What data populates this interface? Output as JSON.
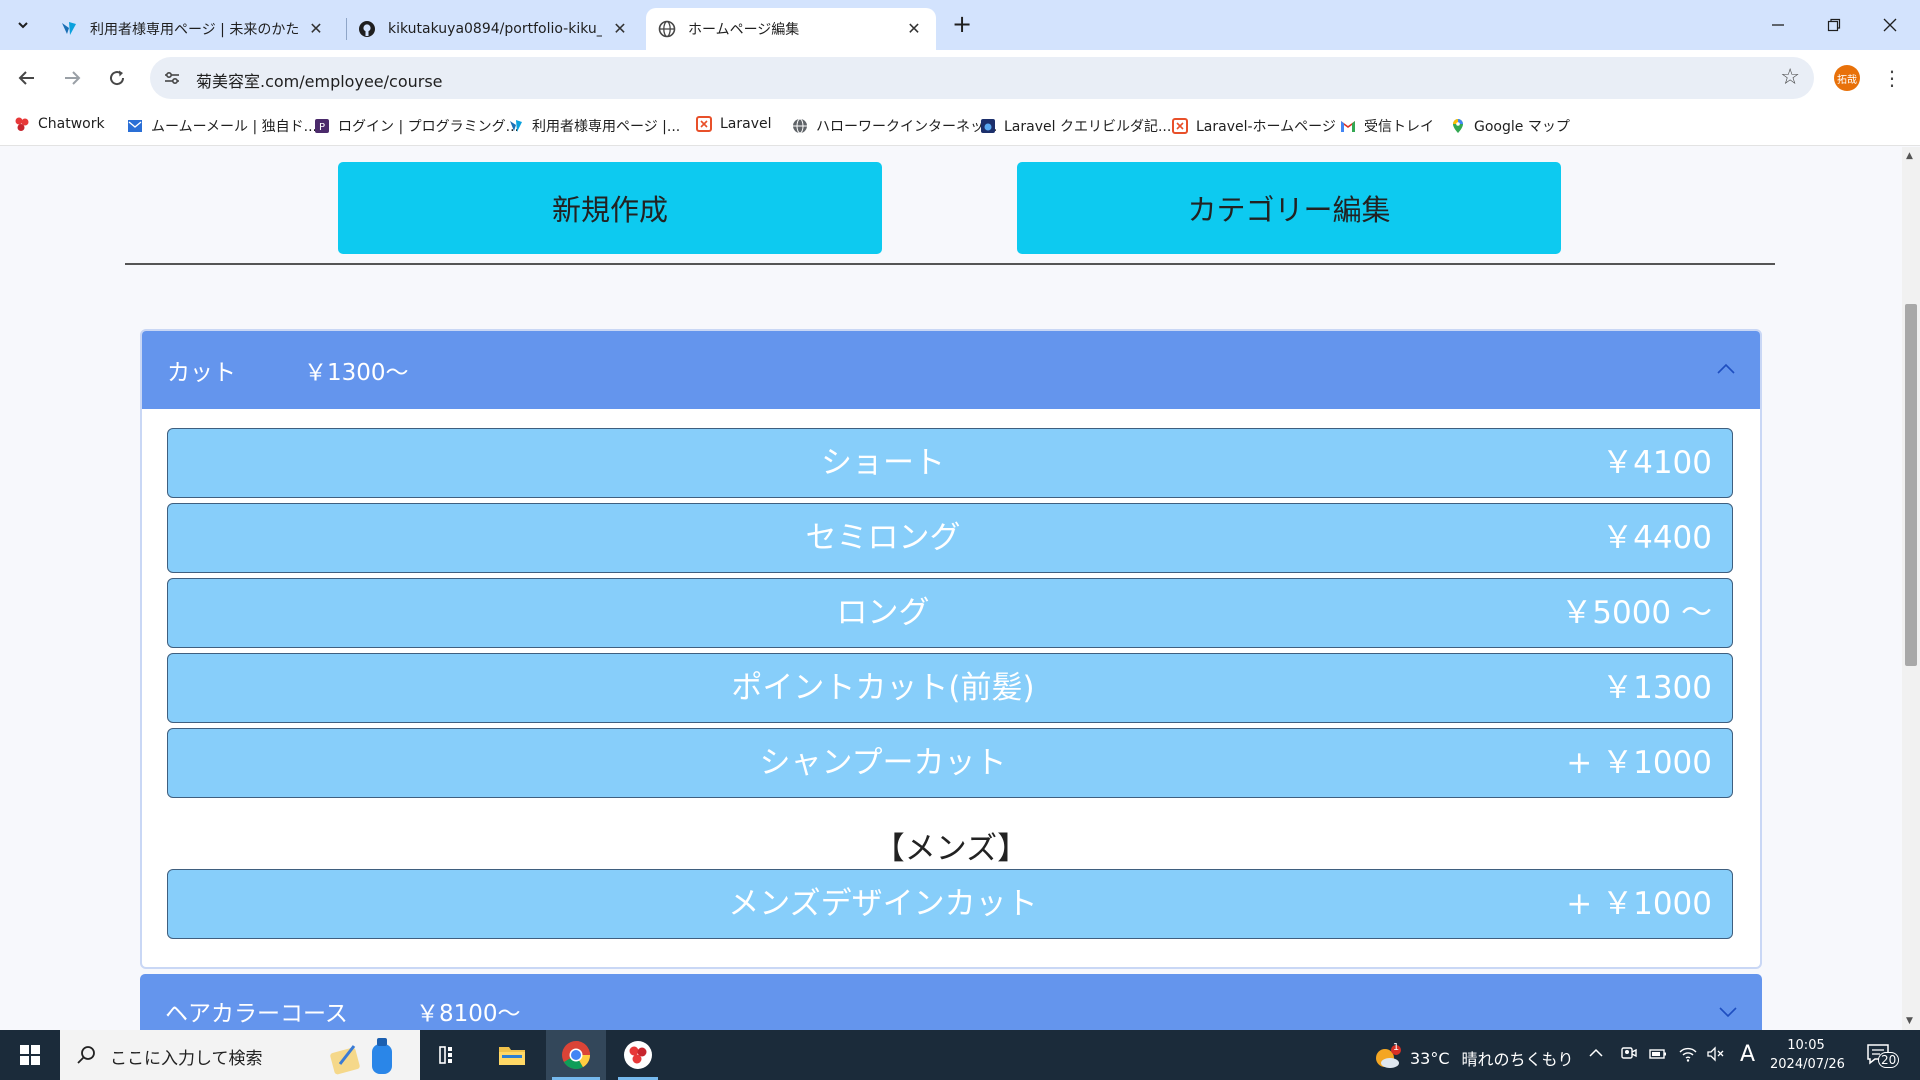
{
  "browser": {
    "tabs": [
      {
        "title": "利用者様専用ページ | 未来のかた",
        "icon": "app-favicon-icon",
        "active": false
      },
      {
        "title": "kikutakuya0894/portfolio-kiku_",
        "icon": "github-icon",
        "active": false
      },
      {
        "title": "ホームページ編集",
        "icon": "globe-icon",
        "active": true
      }
    ],
    "url": "菊美容室.com/employee/course",
    "profile_initials": "拓哉",
    "bookmarks": [
      {
        "label": "Chatwork",
        "icon": "chatwork-icon"
      },
      {
        "label": "ムームーメール | 独自ド...",
        "icon": "mail-icon"
      },
      {
        "label": "ログイン | プログラミング...",
        "icon": "programming-icon"
      },
      {
        "label": "利用者様専用ページ |...",
        "icon": "app-favicon-icon"
      },
      {
        "label": "Laravel",
        "icon": "laravel-icon"
      },
      {
        "label": "ハローワークインターネッ...",
        "icon": "globe-icon"
      },
      {
        "label": "Laravel クエリビルダ記...",
        "icon": "bookmark-site-icon"
      },
      {
        "label": "Laravel-ホームページ",
        "icon": "laravel-icon"
      },
      {
        "label": "受信トレイ",
        "icon": "gmail-icon"
      },
      {
        "label": "Google マップ",
        "icon": "maps-icon"
      }
    ]
  },
  "page": {
    "buttons": {
      "new": "新規作成",
      "category_edit": "カテゴリー編集"
    },
    "accordion": {
      "category": "カット",
      "price": "￥1300〜",
      "items": [
        {
          "name": "ショート",
          "price": "￥4100"
        },
        {
          "name": "セミロング",
          "price": "￥4400"
        },
        {
          "name": "ロング",
          "price": "￥5000 〜"
        },
        {
          "name": "ポイントカット(前髪)",
          "price": "￥1300"
        },
        {
          "name": "シャンプーカット",
          "price": "+ ￥1000"
        }
      ],
      "mens_label": "【メンズ】",
      "mens_items": [
        {
          "name": "メンズデザインカット",
          "price": "+ ￥1000"
        }
      ]
    },
    "accordion2": {
      "category": "ヘアカラーコース",
      "price": "￥8100〜"
    }
  },
  "taskbar": {
    "search_placeholder": "ここに入力して検索",
    "weather": {
      "temp": "33°C",
      "desc": "晴れのちくもり",
      "badge": "1"
    },
    "ime": "A",
    "time": "10:05",
    "date": "2024/07/26",
    "notification_count": "20"
  },
  "colors": {
    "tab_strip": "#d3e3fd",
    "primary_button": "#0dcaf0",
    "accordion_header": "#6495ed",
    "item_bg": "#87cefa",
    "taskbar": "#1b2b3a"
  }
}
